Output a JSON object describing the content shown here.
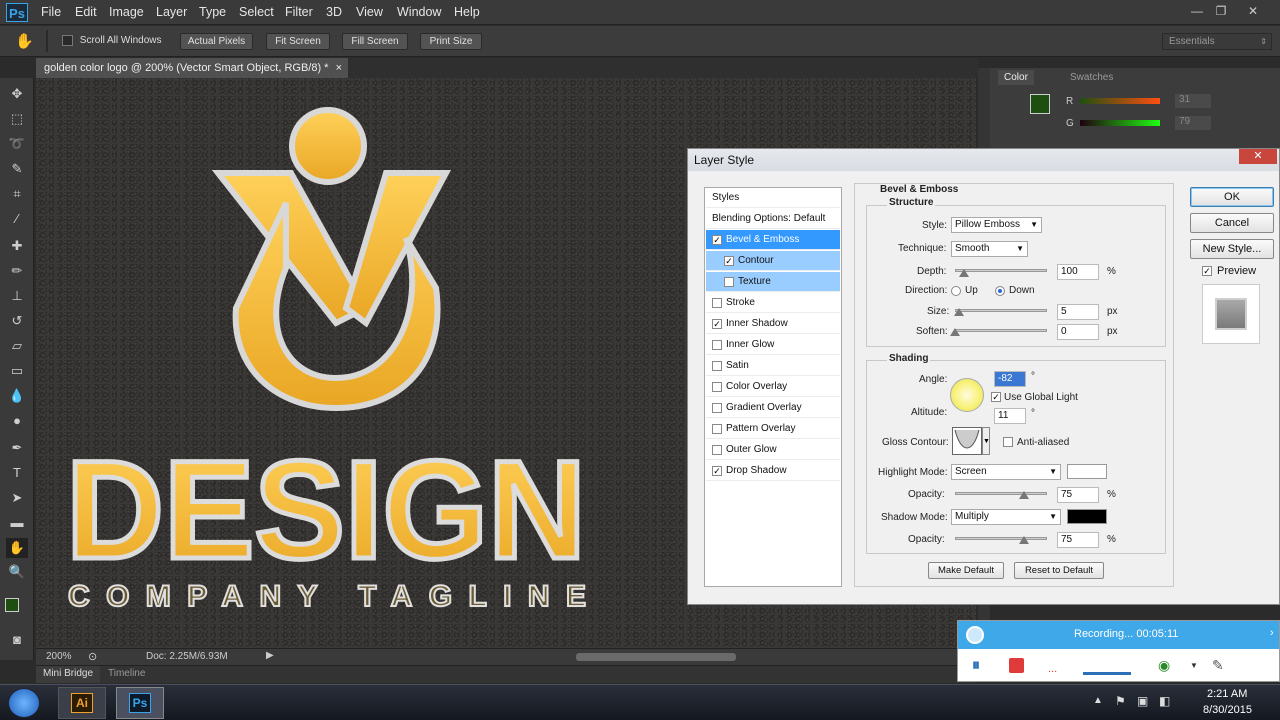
{
  "app": {
    "logo": "Ps"
  },
  "menu": [
    "File",
    "Edit",
    "Image",
    "Layer",
    "Type",
    "Select",
    "Filter",
    "3D",
    "View",
    "Window",
    "Help"
  ],
  "options": {
    "scroll_all": "Scroll All Windows",
    "buttons": [
      "Actual Pixels",
      "Fit Screen",
      "Fill Screen",
      "Print Size"
    ],
    "workspace": "Essentials"
  },
  "document": {
    "tab_title": "golden color logo @ 200% (Vector Smart Object, RGB/8) *",
    "tab_close": "×",
    "zoom": "200%",
    "doc_size": "Doc: 2.25M/6.93M",
    "logo_main": "DESIGN",
    "logo_tagline": "COMPANY TAGLINE"
  },
  "bottom_tabs": [
    "Mini Bridge",
    "Timeline"
  ],
  "color_panel": {
    "tabs": [
      "Color",
      "Swatches"
    ],
    "r_label": "R",
    "r_value": "31",
    "g_label": "G",
    "g_value": "79",
    "fg_color": "#1f4f10"
  },
  "dialog": {
    "title": "Layer Style",
    "close": "✕",
    "styles_header": "Styles",
    "blending": "Blending Options: Default",
    "style_items": [
      {
        "label": "Bevel & Emboss",
        "checked": true
      },
      {
        "label": "Contour",
        "checked": true
      },
      {
        "label": "Texture",
        "checked": false
      },
      {
        "label": "Stroke",
        "checked": false
      },
      {
        "label": "Inner Shadow",
        "checked": true
      },
      {
        "label": "Inner Glow",
        "checked": false
      },
      {
        "label": "Satin",
        "checked": false
      },
      {
        "label": "Color Overlay",
        "checked": false
      },
      {
        "label": "Gradient Overlay",
        "checked": false
      },
      {
        "label": "Pattern Overlay",
        "checked": false
      },
      {
        "label": "Outer Glow",
        "checked": false
      },
      {
        "label": "Drop Shadow",
        "checked": true
      }
    ],
    "section_title": "Bevel & Emboss",
    "structure": {
      "title": "Structure",
      "style_label": "Style:",
      "style_value": "Pillow Emboss",
      "technique_label": "Technique:",
      "technique_value": "Smooth",
      "depth_label": "Depth:",
      "depth_value": "100",
      "depth_unit": "%",
      "direction_label": "Direction:",
      "up": "Up",
      "down": "Down",
      "size_label": "Size:",
      "size_value": "5",
      "size_unit": "px",
      "soften_label": "Soften:",
      "soften_value": "0",
      "soften_unit": "px"
    },
    "shading": {
      "title": "Shading",
      "angle_label": "Angle:",
      "angle_value": "-82",
      "angle_unit": "°",
      "global_light": "Use Global Light",
      "altitude_label": "Altitude:",
      "altitude_value": "11",
      "altitude_unit": "°",
      "gloss_label": "Gloss Contour:",
      "anti_aliased": "Anti-aliased",
      "highlight_label": "Highlight Mode:",
      "highlight_value": "Screen",
      "highlight_color": "#ffffff",
      "hl_opacity_label": "Opacity:",
      "hl_opacity_value": "75",
      "hl_opacity_unit": "%",
      "shadow_label": "Shadow Mode:",
      "shadow_value": "Multiply",
      "shadow_color": "#000000",
      "sh_opacity_label": "Opacity:",
      "sh_opacity_value": "75",
      "sh_opacity_unit": "%"
    },
    "make_default": "Make Default",
    "reset_default": "Reset to Default",
    "ok": "OK",
    "cancel": "Cancel",
    "new_style": "New Style...",
    "preview": "Preview"
  },
  "recording": {
    "text": "Recording... 00:05:11"
  },
  "taskbar": {
    "ai": "Ai",
    "ps": "Ps",
    "time": "2:21 AM",
    "date": "8/30/2015"
  }
}
